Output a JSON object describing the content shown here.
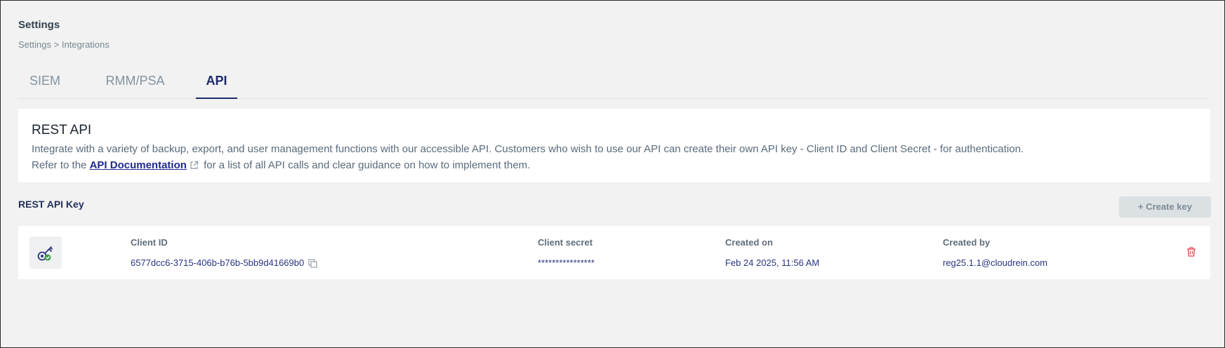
{
  "header": {
    "title": "Settings",
    "breadcrumb": {
      "root": "Settings",
      "separator": ">",
      "current": "Integrations"
    }
  },
  "tabs": [
    {
      "label": "SIEM",
      "active": false
    },
    {
      "label": "RMM/PSA",
      "active": false
    },
    {
      "label": "API",
      "active": true
    }
  ],
  "rest_api": {
    "title": "REST API",
    "line1": "Integrate with a variety of backup, export, and user management functions with our accessible API. Customers who wish to use our API can create their own API key - Client ID and Client Secret - for authentication.",
    "line2_prefix": "Refer to the",
    "doc_link": "API Documentation",
    "line2_suffix": "for a list of all API calls and clear guidance on how to implement them."
  },
  "keys_section": {
    "title": "REST API Key",
    "create_button": "+  Create key"
  },
  "key": {
    "client_id_label": "Client ID",
    "client_id": "6577dcc6-3715-406b-b76b-5bb9d41669b0",
    "client_secret_label": "Client secret",
    "client_secret": "****************",
    "created_on_label": "Created on",
    "created_on": "Feb 24 2025, 11:56 AM",
    "created_by_label": "Created by",
    "created_by": "reg25.1.1@cloudrein.com"
  },
  "icons": {
    "key": "key-icon",
    "copy": "copy-icon",
    "delete": "trash-icon",
    "external": "external-link-icon"
  },
  "colors": {
    "accent": "#1e2a6b",
    "link": "#1e2a8e",
    "danger": "#e5484d",
    "success": "#3aa34a"
  }
}
